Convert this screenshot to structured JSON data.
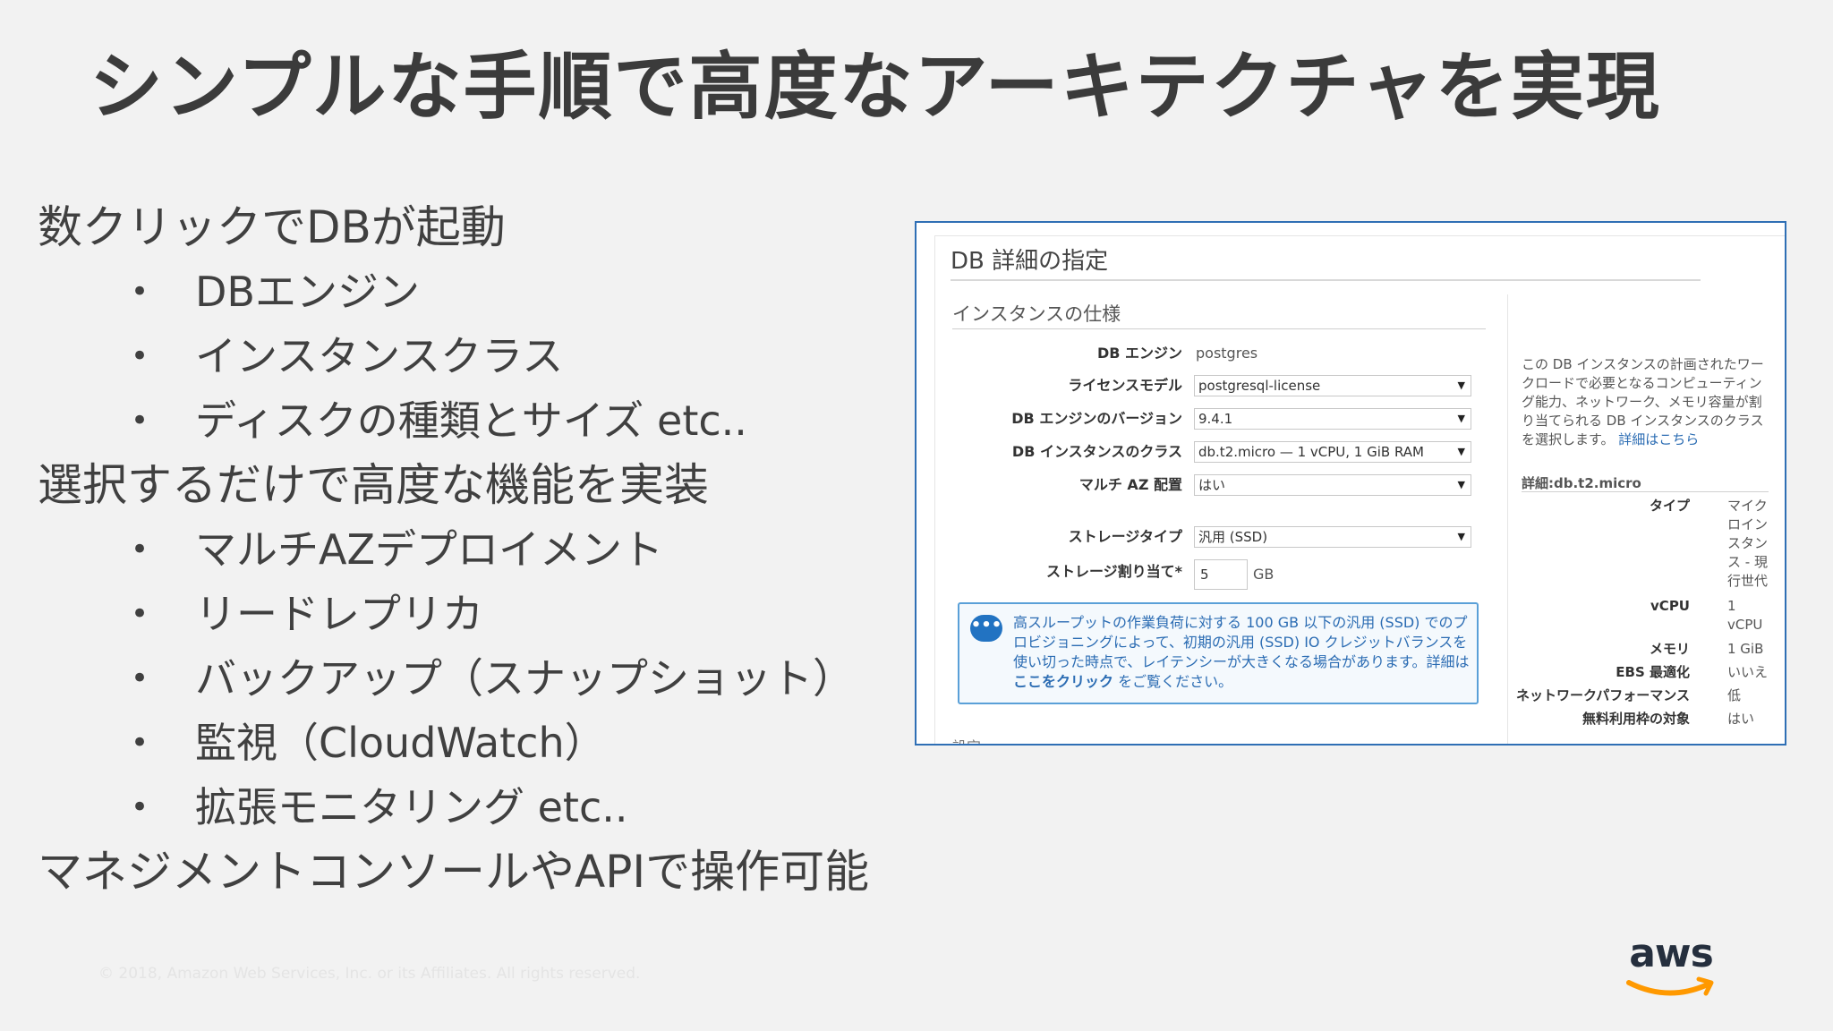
{
  "slide": {
    "title": "シンプルな手順で高度なアーキテクチャを実現",
    "bullet_symbol": "•",
    "sections": [
      {
        "heading": "数クリックでDBが起動",
        "items": [
          "DBエンジン",
          "インスタンスクラス",
          "ディスクの種類とサイズ etc.."
        ]
      },
      {
        "heading": "選択するだけで高度な機能を実装",
        "items": [
          "マルチAZデプロイメント",
          "リードレプリカ",
          "バックアップ（スナップショット）",
          "監視（CloudWatch）",
          "拡張モニタリング etc.."
        ]
      },
      {
        "heading": "マネジメントコンソールやAPIで操作可能",
        "items": []
      }
    ],
    "copyright": "© 2018, Amazon Web Services, Inc. or its Affiliates. All rights reserved.",
    "logo_text": "aws",
    "colors": {
      "background": "#f2f2f2",
      "screenshot_border": "#2f6fb5",
      "aws_orange": "#ff9900",
      "link_blue": "#2b6cb3"
    }
  },
  "console": {
    "heading": "DB 詳細の指定",
    "section_title": "インスタンスの仕様",
    "fields": {
      "engine": {
        "label": "DB エンジン",
        "value": "postgres"
      },
      "license": {
        "label": "ライセンスモデル",
        "value": "postgresql-license"
      },
      "version": {
        "label": "DB エンジンのバージョン",
        "value": "9.4.1"
      },
      "instance_class": {
        "label": "DB インスタンスのクラス",
        "value": "db.t2.micro — 1 vCPU, 1 GiB RAM"
      },
      "multi_az": {
        "label": "マルチ AZ 配置",
        "value": "はい"
      },
      "storage_type": {
        "label": "ストレージタイプ",
        "value": "汎用 (SSD)"
      },
      "storage_alloc": {
        "label": "ストレージ割り当て*",
        "value": "5",
        "unit": "GB"
      }
    },
    "info": {
      "icon": "chat-bubble-icon",
      "text": "高スループットの作業負荷に対する 100 GB 以下の汎用 (SSD) でのプロビジョニングによって、初期の汎用 (SSD) IO クレジットバランスを使い切った時点で、レイテンシーが大きくなる場合があります。詳細は",
      "link": "ここをクリック",
      "suffix": "をご覧ください。"
    },
    "cut_text": "設定",
    "sidebar": {
      "description": "この DB インスタンスの計画されたワークロードで必要となるコンピューティング能力、ネットワーク、メモリ容量が割り当てられる DB インスタンスのクラスを選択します。",
      "description_link": "詳細はこちら",
      "detail_title": "詳細:db.t2.micro",
      "rows": [
        {
          "key": "タイプ",
          "value": "マイクロインスタンス - 現行世代"
        },
        {
          "key": "vCPU",
          "value": "1 vCPU"
        },
        {
          "key": "メモリ",
          "value": "1 GiB"
        },
        {
          "key": "EBS 最適化",
          "value": "いいえ"
        },
        {
          "key": "ネットワークパフォーマンス",
          "value": "低"
        },
        {
          "key": "無料利用枠の対象",
          "value": "はい"
        }
      ]
    }
  }
}
